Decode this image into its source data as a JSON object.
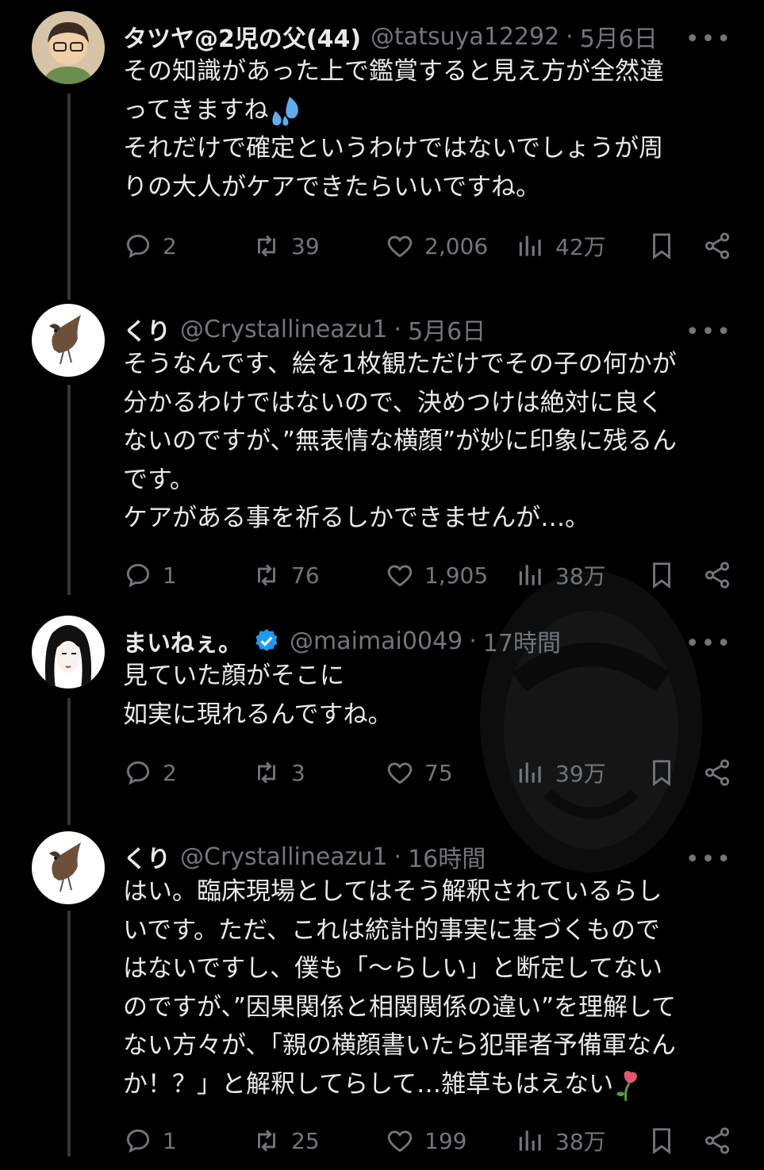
{
  "posts": [
    {
      "name": "タツヤ@2児の父(44)",
      "handle": "@tatsuya12292",
      "time": "5月6日",
      "lines": [
        "その知識があった上で鑑賞すると見え方が全然違",
        "ってきますね",
        "それだけで確定というわけではないでしょうが周",
        "りの大人がケアできたらいいですね。"
      ],
      "replies": "2",
      "reposts": "39",
      "likes": "2,006",
      "views": "42万"
    },
    {
      "name": "くり",
      "handle": "@Crystallineazu1",
      "time": "5月6日",
      "lines": [
        "そうなんです、絵を1枚観ただけでその子の何かが",
        "分かるわけではないので、決めつけは絶対に良く",
        "ないのですが、”無表情な横顔”が妙に印象に残るん",
        "です。",
        "ケアがある事を祈るしかできませんが…。"
      ],
      "replies": "1",
      "reposts": "76",
      "likes": "1,905",
      "views": "38万"
    },
    {
      "name": "まいねぇ。",
      "handle": "@maimai0049",
      "time": "17時間",
      "lines": [
        "見ていた顔がそこに",
        "如実に現れるんですね。"
      ],
      "replies": "2",
      "reposts": "3",
      "likes": "75",
      "views": "39万"
    },
    {
      "name": "くり",
      "handle": "@Crystallineazu1",
      "time": "16時間",
      "lines": [
        "はい。臨床現場としてはそう解釈されているらし",
        "いです。ただ、これは統計的事実に基づくもので",
        "はないですし、僕も「〜らしい」と断定してない",
        "のですが、”因果関係と相関関係の違い”を理解して",
        "ない方々が、「親の横顔書いたら犯罪者予備軍なん",
        "か！？」と解釈してらして…雑草もはえない"
      ],
      "replies": "1",
      "reposts": "25",
      "likes": "199",
      "views": "38万"
    }
  ],
  "more_label": "•••",
  "separator": "·",
  "colors": {
    "accent": "#1d9bf0",
    "muted": "#71767b",
    "text": "#e7e9ea",
    "background": "#000000"
  }
}
